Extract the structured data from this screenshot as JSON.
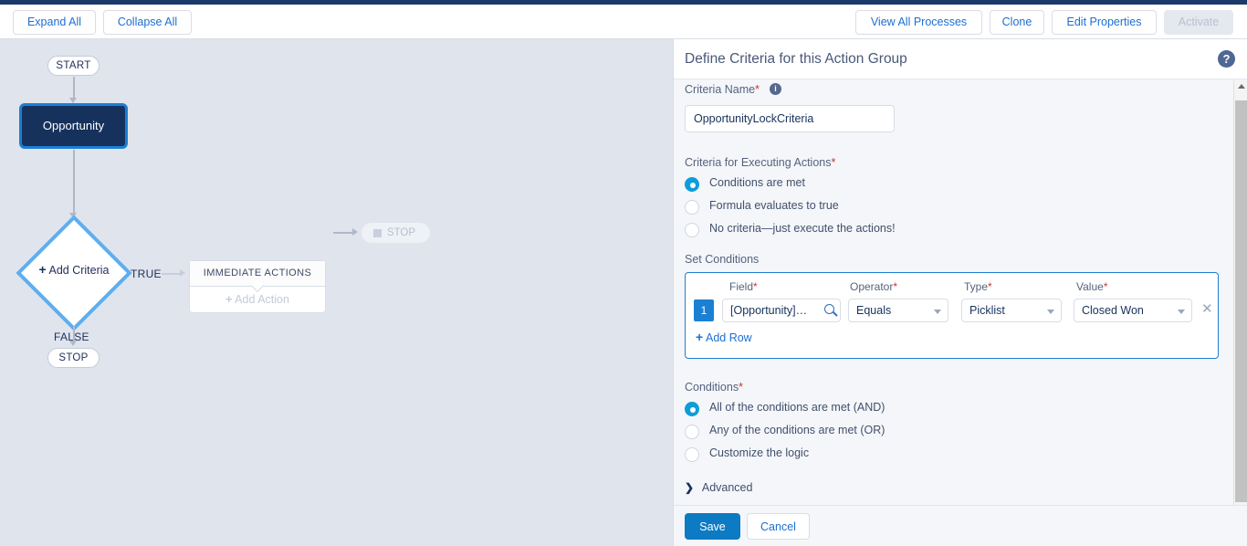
{
  "toolbar": {
    "expand_all": "Expand All",
    "collapse_all": "Collapse All",
    "view_all_processes": "View All Processes",
    "clone": "Clone",
    "edit_properties": "Edit Properties",
    "activate": "Activate"
  },
  "canvas": {
    "start_label": "START",
    "object_node_label": "Opportunity",
    "criteria_node_plus": "+",
    "criteria_node_label": "Add Criteria",
    "branch_true": "TRUE",
    "branch_false": "FALSE",
    "stop_false_label": "STOP",
    "stop_right_label": "STOP",
    "action_group_header": "IMMEDIATE ACTIONS",
    "add_action_plus": "+",
    "add_action_label": "Add Action"
  },
  "panel": {
    "title": "Define Criteria for this Action Group",
    "help_icon_glyph": "?",
    "info_icon_glyph": "i",
    "criteria_name": {
      "label": "Criteria Name",
      "required_mark": "*",
      "value": "OpportunityLockCriteria"
    },
    "criteria_for_executing": {
      "label": "Criteria for Executing Actions",
      "required_mark": "*",
      "options": [
        {
          "label": "Conditions are met",
          "selected": true
        },
        {
          "label": "Formula evaluates to true",
          "selected": false
        },
        {
          "label": "No criteria—just execute the actions!",
          "selected": false
        }
      ]
    },
    "set_conditions": {
      "label": "Set Conditions",
      "columns": [
        {
          "label": "Field",
          "required_mark": "*"
        },
        {
          "label": "Operator",
          "required_mark": "*"
        },
        {
          "label": "Type",
          "required_mark": "*"
        },
        {
          "label": "Value",
          "required_mark": "*"
        }
      ],
      "rows": [
        {
          "number": "1",
          "field": "[Opportunity]…",
          "operator": "Equals",
          "type": "Picklist",
          "value": "Closed Won",
          "delete_glyph": "✕"
        }
      ],
      "add_row_plus": "+",
      "add_row_label": "Add Row"
    },
    "conditions": {
      "label": "Conditions",
      "required_mark": "*",
      "options": [
        {
          "label": "All of the conditions are met (AND)",
          "selected": true
        },
        {
          "label": "Any of the conditions are met (OR)",
          "selected": false
        },
        {
          "label": "Customize the logic",
          "selected": false
        }
      ]
    },
    "advanced": {
      "chevron": "❯",
      "label": "Advanced"
    },
    "footer": {
      "save": "Save",
      "cancel": "Cancel"
    }
  },
  "colors": {
    "brand_blue": "#1b7fd4",
    "navy": "#16325c",
    "save_blue": "#0d7ac4",
    "radio_on": "#0d9dda",
    "canvas_bg": "#dfe4ed",
    "required_red": "#c23934"
  }
}
